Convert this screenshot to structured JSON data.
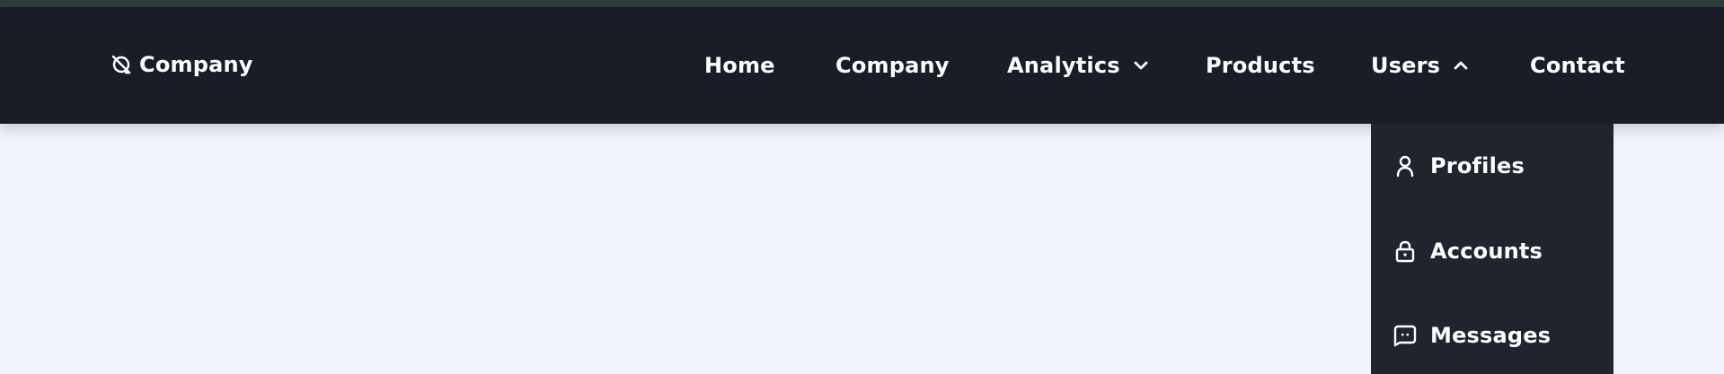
{
  "brand": {
    "name": "Company",
    "icon": "planet-icon"
  },
  "nav": {
    "items": [
      {
        "label": "Home"
      },
      {
        "label": "Company"
      },
      {
        "label": "Analytics",
        "icon": "chevron-down-icon"
      },
      {
        "label": "Products"
      },
      {
        "label": "Users",
        "icon": "chevron-up-icon",
        "expanded": true
      },
      {
        "label": "Contact"
      }
    ]
  },
  "users_menu": {
    "items": [
      {
        "label": "Profiles",
        "icon": "user-icon"
      },
      {
        "label": "Accounts",
        "icon": "lock-icon"
      },
      {
        "label": "Messages",
        "icon": "message-icon"
      }
    ]
  },
  "colors": {
    "navbar": "#191d27",
    "dropdown": "#1f242f",
    "page_background": "#eff4fd",
    "top_strip": "#2c3f3b",
    "text": "#ffffff"
  }
}
